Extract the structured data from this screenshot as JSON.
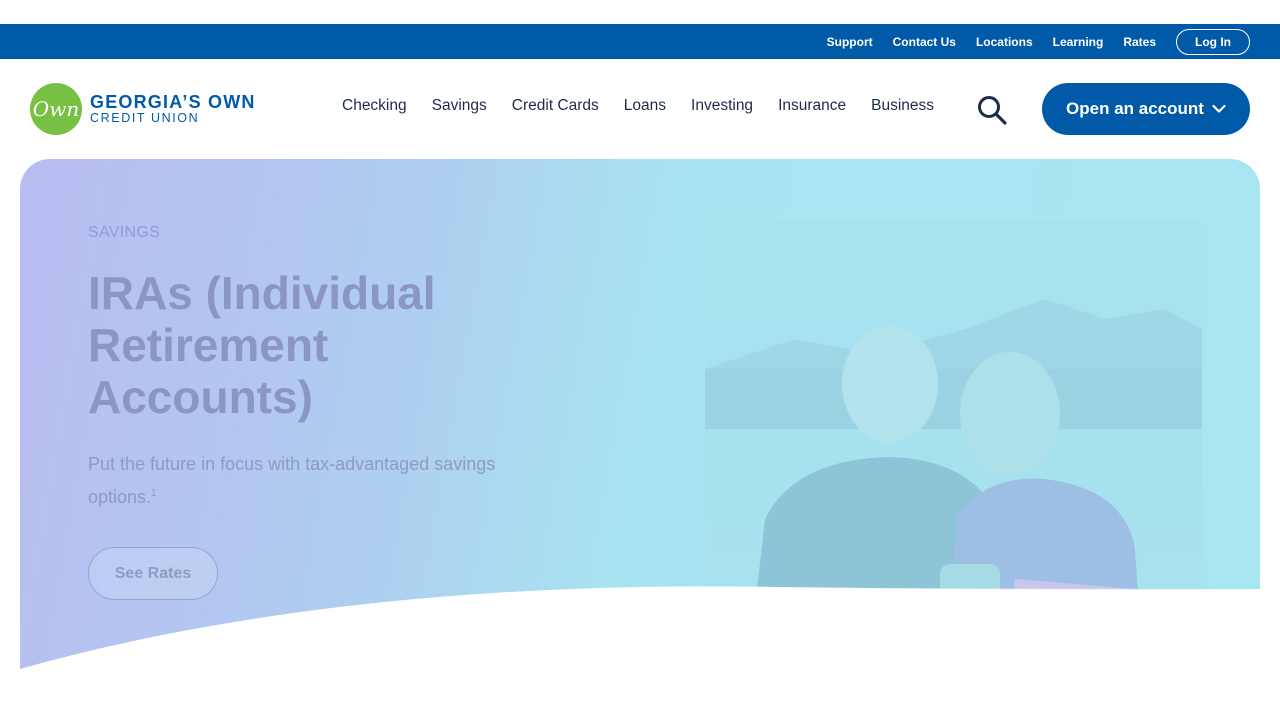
{
  "utility_nav": {
    "links": [
      "Support",
      "Contact Us",
      "Locations",
      "Learning",
      "Rates"
    ],
    "login_label": "Log In"
  },
  "logo": {
    "mark": "Own",
    "line1": "GEORGIA’S OWN",
    "line2": "CREDIT UNION"
  },
  "main_nav": {
    "items": [
      "Checking",
      "Savings",
      "Credit Cards",
      "Loans",
      "Investing",
      "Insurance",
      "Business"
    ],
    "search_icon": "search-icon",
    "open_account_label": "Open an account"
  },
  "hero": {
    "eyebrow": "SAVINGS",
    "title": "IRAs (Individual Retirement Accounts)",
    "subtitle": "Put the future in focus with tax-advantaged savings options.",
    "footnote": "1",
    "cta_label": "See Rates"
  },
  "colors": {
    "brand_blue": "#005aa7",
    "logo_green": "#77c043",
    "nav_text": "#1d2d49"
  }
}
